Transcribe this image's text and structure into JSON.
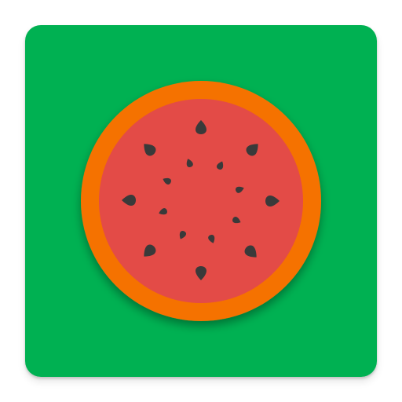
{
  "icon": {
    "name": "watermelon-slice-icon",
    "colors": {
      "background": "#00b152",
      "rind": "#f57200",
      "flesh": "#e34b46",
      "seed": "#3a3a3a"
    }
  }
}
